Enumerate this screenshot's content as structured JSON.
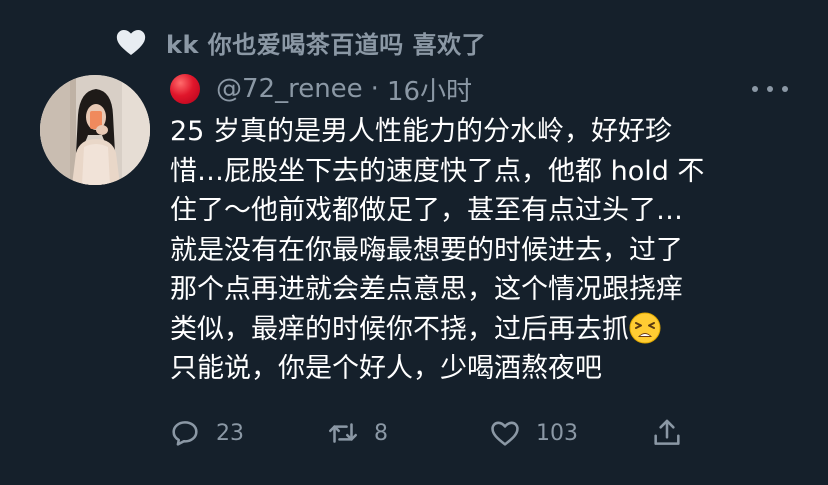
{
  "social_context": {
    "icon": "heart-icon",
    "text": "kk 你也爱喝茶百道吗 喜欢了"
  },
  "tweet": {
    "avatar": "avatar",
    "name_emoji": "red-circle",
    "handle": "@72_renee",
    "separator": "·",
    "time": "16小时",
    "body_lines": [
      "25 岁真的是男人性能力的分水岭，好好珍",
      "惜…屁股坐下去的速度快了点，他都 hold 不",
      "住了～他前戏都做足了，甚至有点过头了…",
      "就是没有在你最嗨最想要的时候进去，过了",
      "那个点再进就会差点意思，这个情况跟挠痒",
      "类似，最痒的时候你不挠，过后再去抓",
      "只能说，你是个好人，少喝酒熬夜吧"
    ],
    "emoji_after_line": "tired-face-emoji",
    "actions": {
      "reply": {
        "icon": "reply-icon",
        "count": "23"
      },
      "retweet": {
        "icon": "retweet-icon",
        "count": "8"
      },
      "like": {
        "icon": "like-icon",
        "count": "103"
      },
      "share": {
        "icon": "share-icon"
      }
    }
  },
  "colors": {
    "background": "#15202b",
    "secondary_text": "#8b98a5",
    "primary_text": "#ffffff"
  }
}
